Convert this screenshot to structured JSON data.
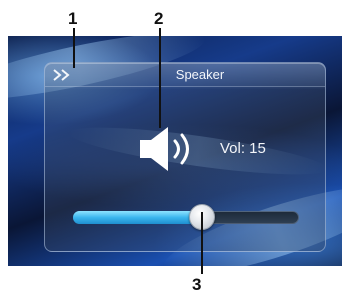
{
  "callouts": [
    "1",
    "2",
    "3"
  ],
  "panel": {
    "title": "Speaker",
    "back_icon": "double-chevron-right-icon",
    "speaker_icon": "speaker-volume-icon"
  },
  "volume": {
    "label": "Vol: 15",
    "level_fraction": 0.57
  },
  "colors": {
    "slider_fill": "#3bb6ee",
    "background": "#163b8a",
    "text": "#f4f6fa"
  }
}
